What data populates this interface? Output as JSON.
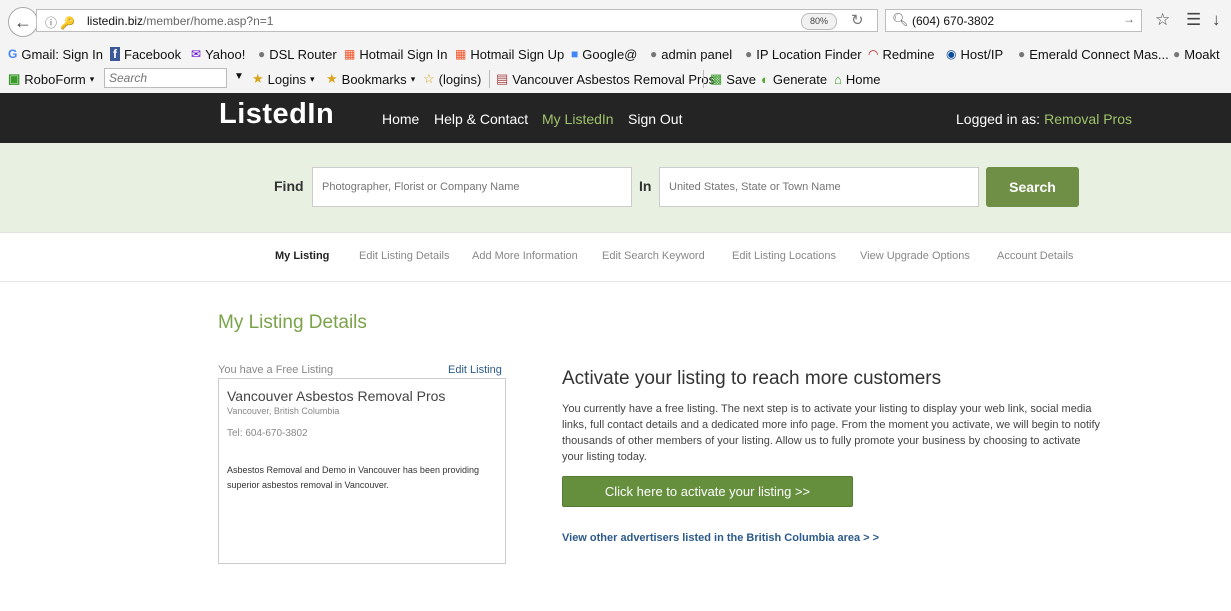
{
  "browser": {
    "url_host": "listedin.biz",
    "url_path": "/member/home.asp?n=1",
    "zoom": "80%",
    "search_query": "(604) 670-3802"
  },
  "bookmarks": [
    {
      "label": "Gmail: Sign In",
      "icon": "google-icon"
    },
    {
      "label": "Facebook",
      "icon": "facebook-icon"
    },
    {
      "label": "Yahoo!",
      "icon": "yahoo-icon"
    },
    {
      "label": "DSL Router",
      "icon": "globe-icon"
    },
    {
      "label": "Hotmail Sign In",
      "icon": "windows-icon"
    },
    {
      "label": "Hotmail Sign Up",
      "icon": "windows-icon"
    },
    {
      "label": "Google@",
      "icon": "google-translate-icon"
    },
    {
      "label": "admin panel",
      "icon": "globe-icon"
    },
    {
      "label": "IP Location Finder",
      "icon": "globe-icon"
    },
    {
      "label": "Redmine",
      "icon": "redmine-icon"
    },
    {
      "label": "Host/IP",
      "icon": "location-pin-icon"
    },
    {
      "label": "Emerald Connect Mas...",
      "icon": "globe-icon"
    },
    {
      "label": "Moakt",
      "icon": "globe-icon"
    }
  ],
  "toolbar": {
    "roboform": "RoboForm",
    "search_placeholder": "Search",
    "logins": "Logins",
    "bookmarks": "Bookmarks",
    "logins2": "(logins)",
    "tab_title": "Vancouver Asbestos Removal Pros",
    "save": "Save",
    "generate": "Generate",
    "home": "Home"
  },
  "header": {
    "logo": "ListedIn",
    "nav": [
      "Home",
      "Help & Contact",
      "My ListedIn",
      "Sign Out"
    ],
    "logged_label": "Logged in as:",
    "user": "Removal Pros"
  },
  "search": {
    "find_label": "Find",
    "find_placeholder": "Photographer, Florist or Company Name",
    "in_label": "In",
    "in_placeholder": "United States, State or Town Name",
    "button": "Search"
  },
  "subnav": [
    "My Listing",
    "Edit Listing Details",
    "Add More Information",
    "Edit Search Keyword",
    "Edit Listing Locations",
    "View Upgrade Options",
    "Account Details"
  ],
  "main": {
    "title": "My Listing Details",
    "free_label": "You have a Free Listing",
    "edit_link": "Edit Listing",
    "listing": {
      "name": "Vancouver Asbestos Removal Pros",
      "location": "Vancouver, British Columbia",
      "tel": "Tel: 604-670-3802",
      "description": "Asbestos Removal and Demo in Vancouver has been providing superior asbestos removal in Vancouver."
    },
    "activate_heading": "Activate your listing to reach more customers",
    "activate_text": "You currently have a free listing. The next step is to activate your listing to display your web link, social media links, full contact details and a dedicated more info page. From the moment you activate, we will begin to notify thousands of other members of your listing. Allow us to fully promote your business by choosing to activate your listing today.",
    "activate_button": "Click here to activate your listing >>",
    "advertisers_link": "View other advertisers listed in the British Columbia area > >"
  },
  "colors": {
    "header_bg": "#242424",
    "accent_green": "#7aa34a",
    "button_green": "#6e8f45",
    "search_band": "#e8f0e2",
    "link_blue": "#2c5a8a"
  }
}
